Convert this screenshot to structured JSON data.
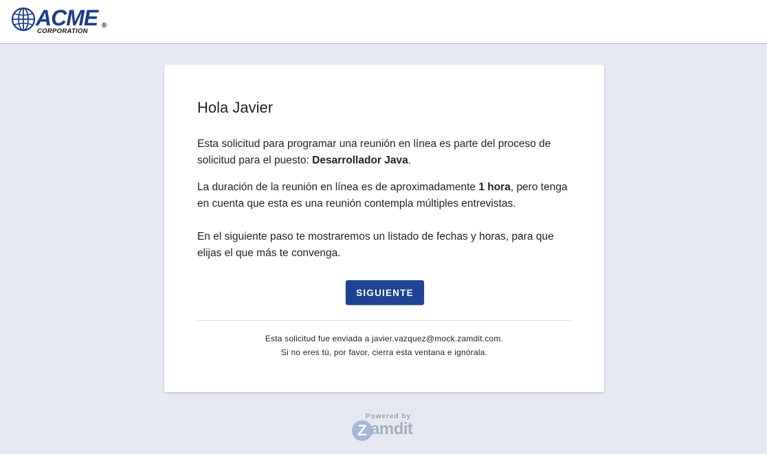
{
  "header": {
    "logo_name": "ACME",
    "logo_subtitle": "CORPORATION",
    "logo_reg": "®",
    "globe_icon": "globe-icon",
    "brand_color": "#1b3c8c"
  },
  "card": {
    "greeting": "Hola Javier",
    "para1_text": "Esta solicitud para programar una reunión en línea es parte del proceso de solicitud para el puesto: ",
    "para1_bold": "Desarrollador Java",
    "para1_end": ".",
    "para2_text": "La duración de la reunión en línea es de aproximadamente ",
    "para2_bold": "1 hora",
    "para2_end": ", pero tenga en cuenta que esta es una reunión contempla múltiples entrevistas.",
    "para3": "En el siguiente paso te mostraremos un listado de fechas y horas, para que elijas el que más te convenga.",
    "next_button": "SIGUIENTE",
    "button_color": "#1f4394",
    "footnote1": "Esta solicitud fue enviada a javier.vazquez@mock.zamdit.com.",
    "footnote2": "Si no eres tú, por favor, cierra esta ventana e ignórala."
  },
  "footer": {
    "powered_by": "Powered by",
    "brand_z": "Z",
    "brand_rest": "amdit"
  }
}
